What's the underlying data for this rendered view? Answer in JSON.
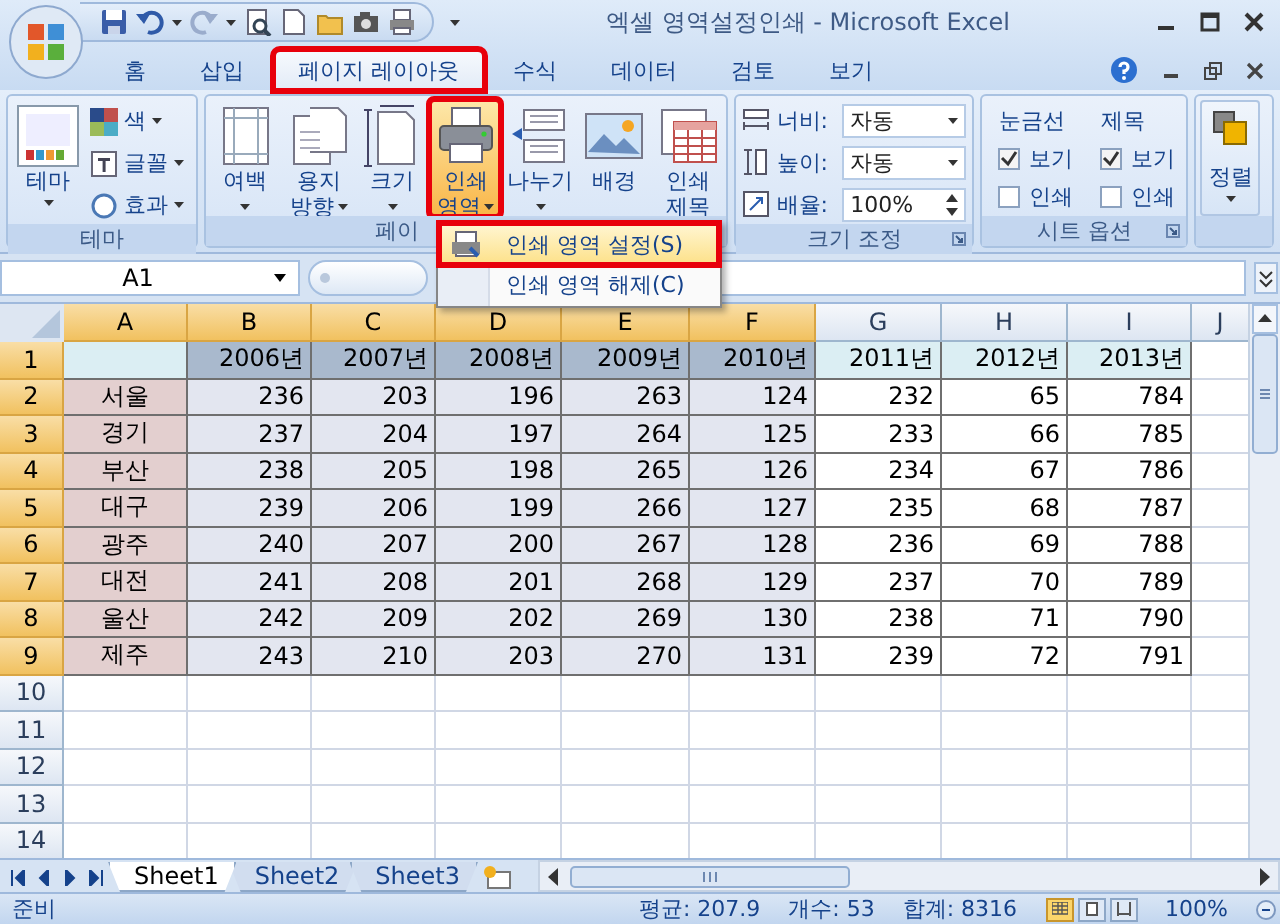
{
  "window": {
    "title": "엑셀 영역설정인쇄 - Microsoft Excel"
  },
  "tabs": [
    {
      "label": "홈",
      "selected": false,
      "annotated": false
    },
    {
      "label": "삽입",
      "selected": false,
      "annotated": false
    },
    {
      "label": "페이지 레이아웃",
      "selected": true,
      "annotated": true
    },
    {
      "label": "수식",
      "selected": false,
      "annotated": false
    },
    {
      "label": "데이터",
      "selected": false,
      "annotated": false
    },
    {
      "label": "검토",
      "selected": false,
      "annotated": false
    },
    {
      "label": "보기",
      "selected": false,
      "annotated": false
    }
  ],
  "ribbon": {
    "theme_group": {
      "label": "테마",
      "button": "테마",
      "options": [
        "색",
        "글꼴",
        "효과"
      ]
    },
    "page_setup_group": {
      "label": "페이",
      "buttons": [
        {
          "kind": "margins",
          "lines": [
            "여백"
          ],
          "dropdown": true,
          "expanded": false,
          "annotated": false
        },
        {
          "kind": "orientation",
          "lines": [
            "용지",
            "방향"
          ],
          "dropdown": true,
          "expanded": false,
          "annotated": false
        },
        {
          "kind": "size",
          "lines": [
            "크기"
          ],
          "dropdown": true,
          "expanded": false,
          "annotated": false
        },
        {
          "kind": "print_area",
          "lines": [
            "인쇄",
            "영역"
          ],
          "dropdown": true,
          "expanded": true,
          "annotated": true
        },
        {
          "kind": "breaks",
          "lines": [
            "나누기"
          ],
          "dropdown": true,
          "expanded": false,
          "annotated": false
        },
        {
          "kind": "background",
          "lines": [
            "배경"
          ],
          "dropdown": false,
          "expanded": false,
          "annotated": false
        },
        {
          "kind": "print_titles",
          "lines": [
            "인쇄",
            "제목"
          ],
          "dropdown": false,
          "expanded": false,
          "annotated": false
        }
      ]
    },
    "scale_group": {
      "label": "크기 조정",
      "rows": [
        {
          "kind": "combo",
          "label": "너비:",
          "value": "자동"
        },
        {
          "kind": "combo",
          "label": "높이:",
          "value": "자동"
        },
        {
          "kind": "spin",
          "label": "배율:",
          "value": "100%"
        }
      ]
    },
    "sheet_options_group": {
      "label": "시트 옵션",
      "columns": [
        {
          "title": "눈금선",
          "options": [
            {
              "label": "보기",
              "checked": true
            },
            {
              "label": "인쇄",
              "checked": false
            }
          ]
        },
        {
          "title": "제목",
          "options": [
            {
              "label": "보기",
              "checked": true
            },
            {
              "label": "인쇄",
              "checked": false
            }
          ]
        }
      ]
    },
    "arrange_group": {
      "button": "정렬"
    }
  },
  "menu": {
    "items": [
      {
        "label": "인쇄 영역 설정(S)",
        "selected": true,
        "annotated": true
      },
      {
        "label": "인쇄 영역 해제(C)",
        "selected": false,
        "annotated": false
      }
    ]
  },
  "formula_bar": {
    "name_box": "A1"
  },
  "sheet": {
    "columns": [
      {
        "label": "A",
        "selected": true
      },
      {
        "label": "B",
        "selected": true
      },
      {
        "label": "C",
        "selected": true
      },
      {
        "label": "D",
        "selected": true
      },
      {
        "label": "E",
        "selected": true
      },
      {
        "label": "F",
        "selected": true
      },
      {
        "label": "G",
        "selected": false
      },
      {
        "label": "H",
        "selected": false
      },
      {
        "label": "I",
        "selected": false
      },
      {
        "label": "J",
        "selected": false
      }
    ],
    "rows": [
      {
        "label": "1",
        "selected": true,
        "kind": "header",
        "cells": [
          "2006년",
          "2007년",
          "2008년",
          "2009년",
          "2010년",
          "2011년",
          "2012년",
          "2013년"
        ]
      },
      {
        "label": "2",
        "selected": true,
        "kind": "data",
        "name": "서울",
        "values": [
          "236",
          "203",
          "196",
          "263",
          "124",
          "232",
          "65",
          "784"
        ]
      },
      {
        "label": "3",
        "selected": true,
        "kind": "data",
        "name": "경기",
        "values": [
          "237",
          "204",
          "197",
          "264",
          "125",
          "233",
          "66",
          "785"
        ]
      },
      {
        "label": "4",
        "selected": true,
        "kind": "data",
        "name": "부산",
        "values": [
          "238",
          "205",
          "198",
          "265",
          "126",
          "234",
          "67",
          "786"
        ]
      },
      {
        "label": "5",
        "selected": true,
        "kind": "data",
        "name": "대구",
        "values": [
          "239",
          "206",
          "199",
          "266",
          "127",
          "235",
          "68",
          "787"
        ]
      },
      {
        "label": "6",
        "selected": true,
        "kind": "data",
        "name": "광주",
        "values": [
          "240",
          "207",
          "200",
          "267",
          "128",
          "236",
          "69",
          "788"
        ]
      },
      {
        "label": "7",
        "selected": true,
        "kind": "data",
        "name": "대전",
        "values": [
          "241",
          "208",
          "201",
          "268",
          "129",
          "237",
          "70",
          "789"
        ]
      },
      {
        "label": "8",
        "selected": true,
        "kind": "data",
        "name": "울산",
        "values": [
          "242",
          "209",
          "202",
          "269",
          "130",
          "238",
          "71",
          "790"
        ]
      },
      {
        "label": "9",
        "selected": true,
        "kind": "data",
        "name": "제주",
        "values": [
          "243",
          "210",
          "203",
          "270",
          "131",
          "239",
          "72",
          "791"
        ]
      },
      {
        "label": "10",
        "selected": false,
        "kind": "empty"
      },
      {
        "label": "11",
        "selected": false,
        "kind": "empty"
      },
      {
        "label": "12",
        "selected": false,
        "kind": "empty"
      },
      {
        "label": "13",
        "selected": false,
        "kind": "empty"
      },
      {
        "label": "14",
        "selected": false,
        "kind": "empty"
      }
    ]
  },
  "sheet_tabs": [
    {
      "label": "Sheet1",
      "selected": true
    },
    {
      "label": "Sheet2",
      "selected": false
    },
    {
      "label": "Sheet3",
      "selected": false
    }
  ],
  "status_bar": {
    "mode": "준비",
    "average": "평균: 207.9",
    "count": "개수: 53",
    "sum": "합계: 8316",
    "views": [
      {
        "selected": true
      },
      {
        "selected": false
      },
      {
        "selected": false
      }
    ],
    "zoom": "100%"
  }
}
